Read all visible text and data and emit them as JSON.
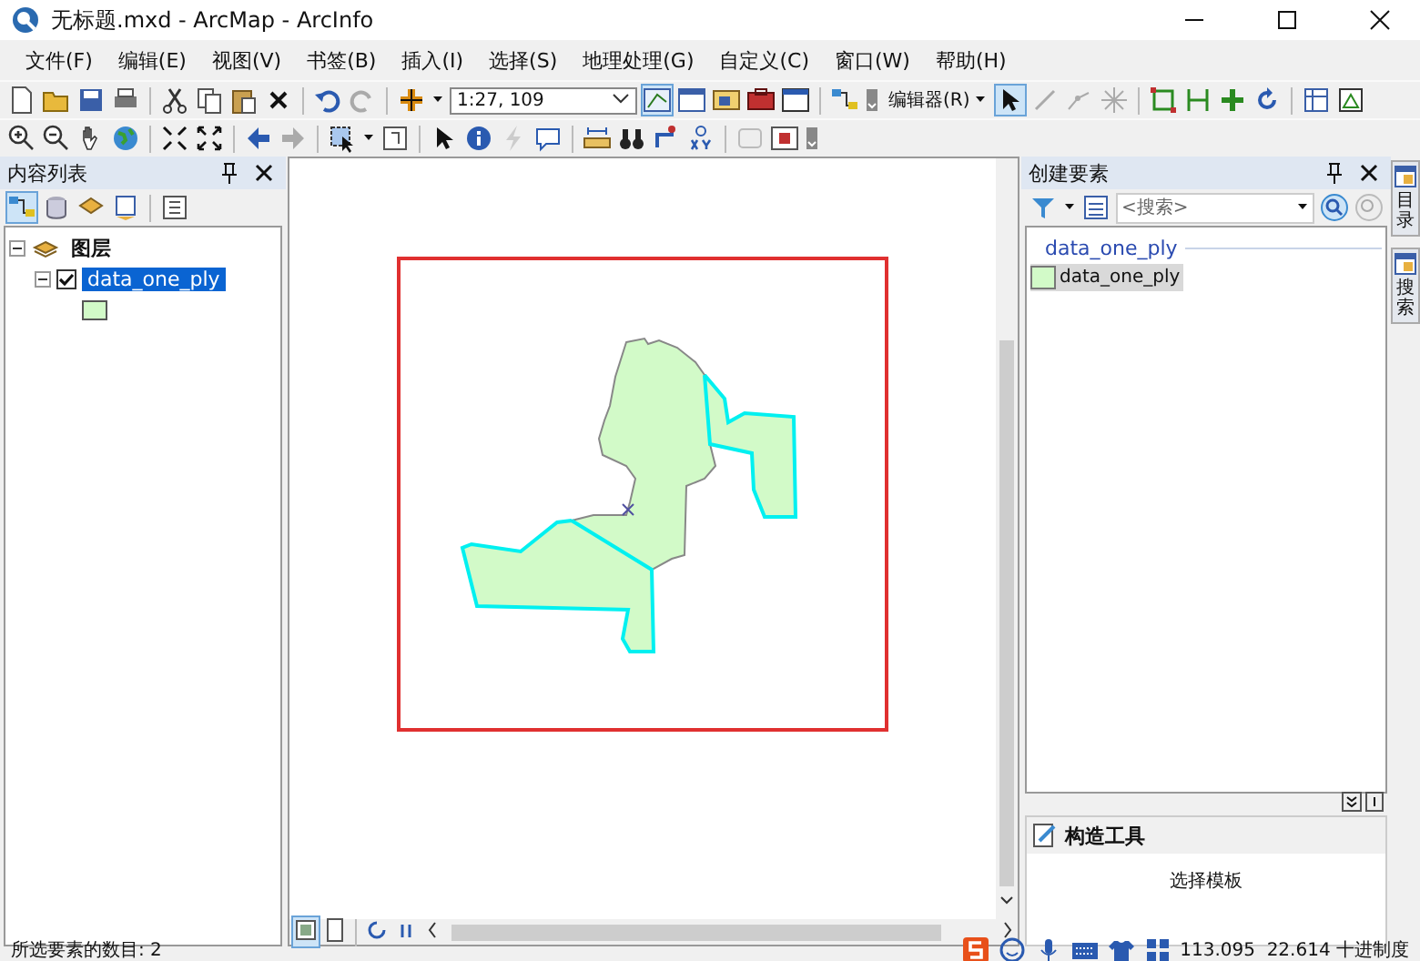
{
  "window": {
    "title": "无标题.mxd - ArcMap - ArcInfo"
  },
  "menu_bar": [
    "文件(F)",
    "编辑(E)",
    "视图(V)",
    "书签(B)",
    "插入(I)",
    "选择(S)",
    "地理处理(G)",
    "自定义(C)",
    "窗口(W)",
    "帮助(H)"
  ],
  "toolbar": {
    "scale": "1:27, 109",
    "editor_menu": "编辑器(R)"
  },
  "table_of_contents": {
    "title": "内容列表",
    "layers": [
      {
        "label": "图层",
        "expanded": true,
        "children": [
          {
            "label": "data_one_ply",
            "checked": true,
            "selected": true,
            "expanded": true
          }
        ]
      }
    ]
  },
  "create_features": {
    "title": "创建要素",
    "search": {
      "placeholder": "<搜索>"
    },
    "template_groups": [
      {
        "label": "data_one_ply",
        "templates": [
          {
            "label": "data_one_ply",
            "selected": true
          }
        ]
      }
    ]
  },
  "construction_tools": {
    "title": "构造工具",
    "message": "选择模板"
  },
  "side_tabs": [
    {
      "label": "目录"
    },
    {
      "label": "搜索"
    }
  ],
  "status_bar": {
    "selection": "所选要素的数目: 2",
    "coordinates": "113.095  22.614 十进制度"
  }
}
